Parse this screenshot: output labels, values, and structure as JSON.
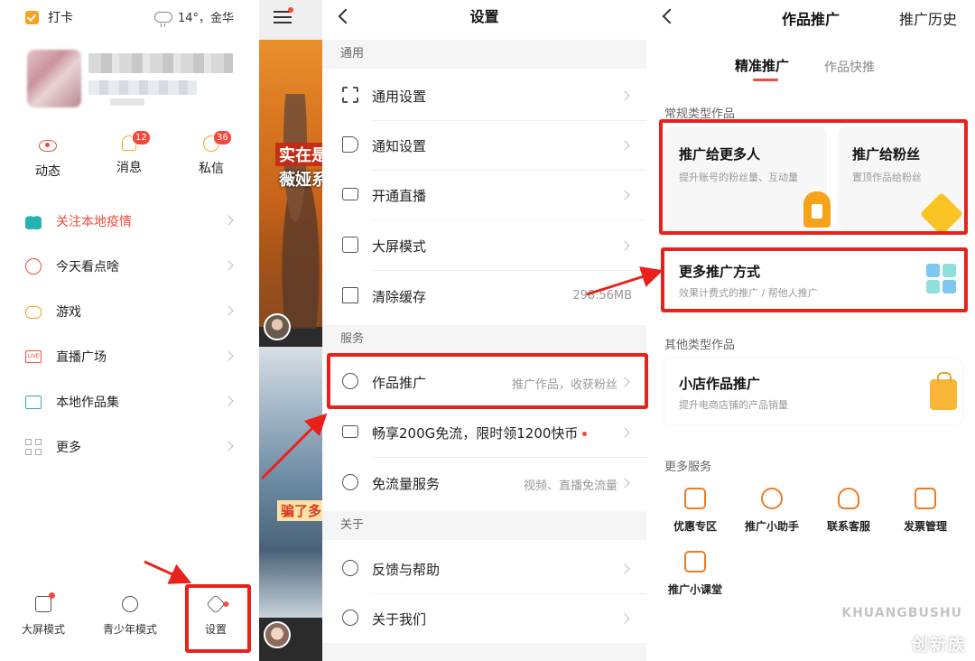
{
  "drawer": {
    "checkin": "打卡",
    "weather": "14°，金华",
    "quick": [
      {
        "label": "动态",
        "icon": "eye-icon"
      },
      {
        "label": "消息",
        "icon": "bell-icon",
        "badge": "12"
      },
      {
        "label": "私信",
        "icon": "chat-icon",
        "badge": "36"
      }
    ],
    "menu": [
      {
        "label": "关注本地疫情",
        "icon": "lung-icon",
        "highlight": true
      },
      {
        "label": "今天看点啥",
        "icon": "discover-icon"
      },
      {
        "label": "游戏",
        "icon": "gamepad-icon"
      },
      {
        "label": "直播广场",
        "icon": "live-icon",
        "icon_text": "LIVE"
      },
      {
        "label": "本地作品集",
        "icon": "folder-icon"
      },
      {
        "label": "更多",
        "icon": "grid-icon"
      }
    ],
    "bottom": [
      {
        "label": "大屏模式",
        "icon": "screen-icon"
      },
      {
        "label": "青少年模式",
        "icon": "teen-icon"
      },
      {
        "label": "设置",
        "icon": "settings-icon"
      }
    ]
  },
  "strip": {
    "video1_caption_a": "实在是",
    "video1_caption_b": "薇娅系",
    "video2_caption": "骗了多"
  },
  "settings": {
    "title": "设置",
    "sections": [
      {
        "title": "通用",
        "rows": [
          {
            "label": "通用设置",
            "sub": ""
          },
          {
            "label": "通知设置",
            "sub": ""
          },
          {
            "label": "开通直播",
            "sub": ""
          },
          {
            "label": "大屏模式",
            "sub": ""
          },
          {
            "label": "清除缓存",
            "sub": "298.56MB"
          }
        ]
      },
      {
        "title": "服务",
        "rows": [
          {
            "label": "作品推广",
            "sub": "推广作品，收获粉丝"
          },
          {
            "label": "畅享200G免流，限时领1200快币",
            "sub": ""
          },
          {
            "label": "免流量服务",
            "sub": "视频、直播免流量"
          }
        ]
      },
      {
        "title": "关于",
        "rows": [
          {
            "label": "反馈与帮助",
            "sub": ""
          },
          {
            "label": "关于我们",
            "sub": ""
          }
        ]
      }
    ]
  },
  "promo": {
    "title": "作品推广",
    "history": "推广历史",
    "tabs": [
      "精准推广",
      "作品快推"
    ],
    "group_regular": "常规类型作品",
    "card_more_people": {
      "title": "推广给更多人",
      "desc": "提升账号的粉丝量、互动量"
    },
    "card_fans": {
      "title": "推广给粉丝",
      "desc": "置顶作品给粉丝"
    },
    "card_more_ways": {
      "title": "更多推广方式",
      "desc": "效果计费式的推广 / 帮他人推广"
    },
    "group_other": "其他类型作品",
    "card_shop": {
      "title": "小店作品推广",
      "desc": "提升电商店铺的产品销量"
    },
    "group_services": "更多服务",
    "services": [
      {
        "label": "优惠专区",
        "icon": "coupon-icon"
      },
      {
        "label": "推广小助手",
        "icon": "assistant-icon"
      },
      {
        "label": "联系客服",
        "icon": "headset-icon"
      },
      {
        "label": "发票管理",
        "icon": "invoice-icon"
      },
      {
        "label": "推广小课堂",
        "icon": "classroom-icon"
      }
    ]
  },
  "watermark": {
    "line1": "KHUANGBUSHU",
    "line2": "创新族"
  },
  "colors": {
    "accent": "#f04a3a",
    "annotation_red": "#e8221a",
    "orange": "#f7a21b",
    "teal": "#23b3b0"
  }
}
